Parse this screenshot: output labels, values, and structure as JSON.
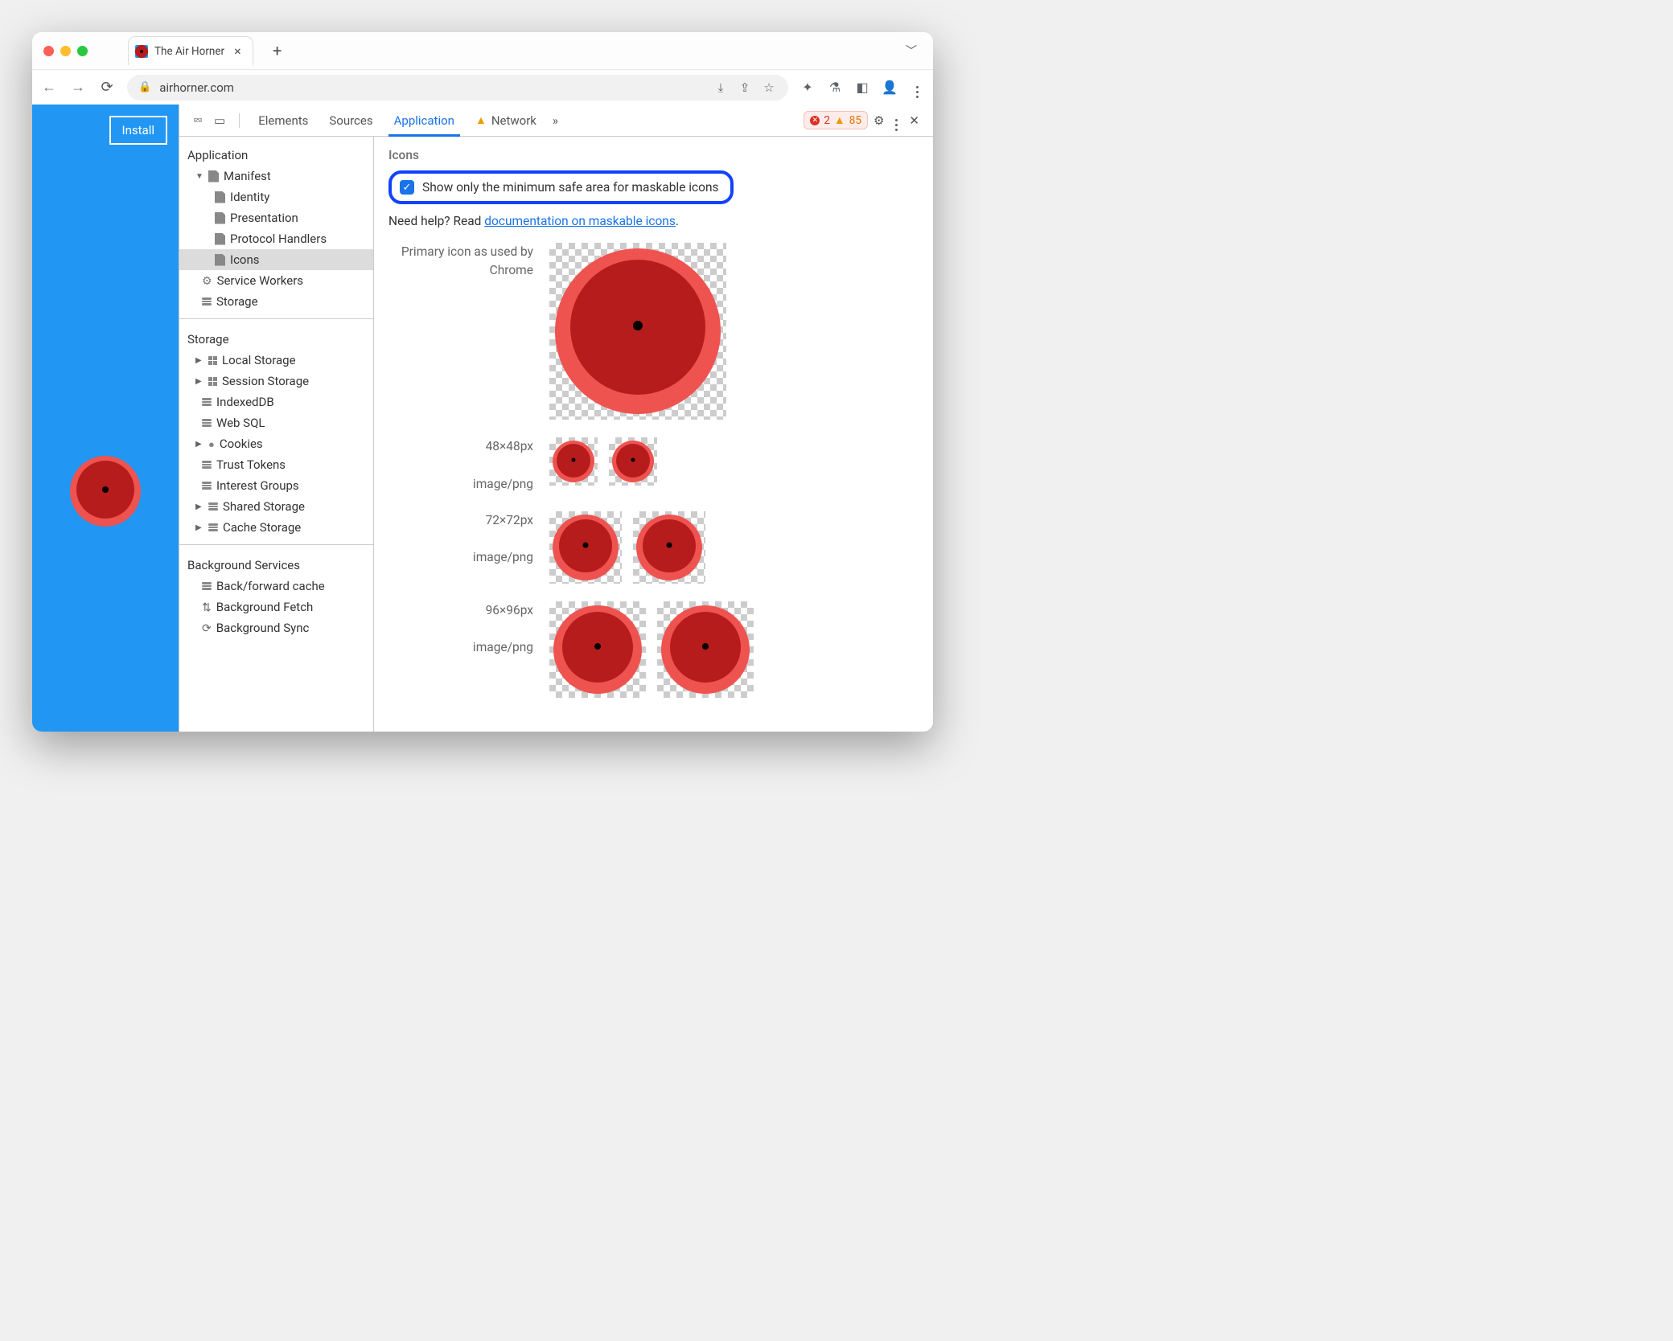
{
  "tab": {
    "title": "The Air Horner"
  },
  "addr": {
    "url": "airhorner.com"
  },
  "page": {
    "install": "Install"
  },
  "devtools": {
    "tabs": {
      "elements": "Elements",
      "sources": "Sources",
      "application": "Application",
      "network": "Network"
    },
    "errors": "2",
    "warnings": "85"
  },
  "side": {
    "application": "Application",
    "manifest": "Manifest",
    "identity": "Identity",
    "presentation": "Presentation",
    "protocol": "Protocol Handlers",
    "icons": "Icons",
    "sw": "Service Workers",
    "storageItem": "Storage",
    "storageHdr": "Storage",
    "local": "Local Storage",
    "session": "Session Storage",
    "idb": "IndexedDB",
    "websql": "Web SQL",
    "cookies": "Cookies",
    "trust": "Trust Tokens",
    "interest": "Interest Groups",
    "shared": "Shared Storage",
    "cache": "Cache Storage",
    "bgHdr": "Background Services",
    "bfcache": "Back/forward cache",
    "bgfetch": "Background Fetch",
    "bgsync": "Background Sync"
  },
  "main": {
    "title": "Icons",
    "checkbox": "Show only the minimum safe area for maskable icons",
    "help_pre": "Need help? Read ",
    "help_link": "documentation on maskable icons",
    "primary_l1": "Primary icon as used by",
    "primary_l2": "Chrome",
    "r1_size": "48×48px",
    "r1_type": "image/png",
    "r2_size": "72×72px",
    "r2_type": "image/png",
    "r3_size": "96×96px",
    "r3_type": "image/png"
  }
}
